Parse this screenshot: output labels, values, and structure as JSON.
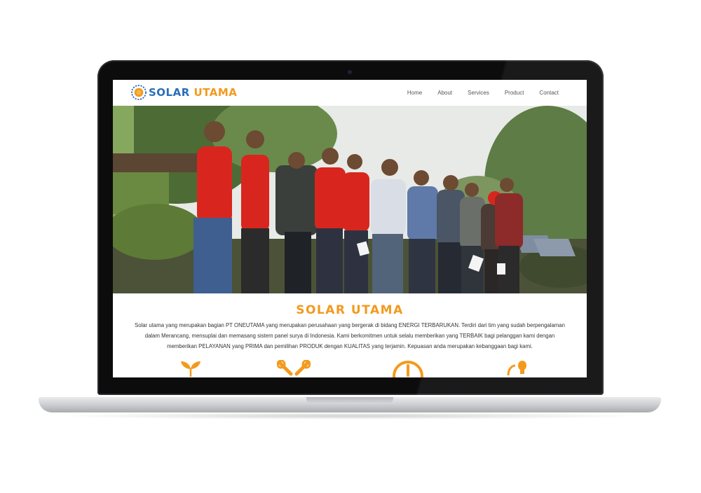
{
  "site": {
    "logo": {
      "part1": "SOLAR",
      "part2": "UTAMA"
    },
    "nav": [
      "Home",
      "About",
      "Services",
      "Product",
      "Contact"
    ]
  },
  "hero": {
    "slides": 3,
    "active_slide": 3
  },
  "intro": {
    "title": "SOLAR UTAMA",
    "paragraph": "Solar utama yang merupakan bagian PT ONEUTAMA yang merupakan perusahaan yang bergerak di bidang ENERGI TERBARUKAN. Terdiri dari tim yang sudah berpengalaman dalam Merancang, mensuplai dan memasang sistem panel surya di Indonesia. Kami berkomitmen untuk selalu memberikan yang TERBAIK bagi pelanggan kami dengan memberikan PELAYANAN yang PRIMA dan pemilihan PRODUK dengan KUALITAS yang terjamin. Kepuasan anda merupakan kebanggaan bagi kami."
  },
  "feature_icons": [
    "leaf-icon",
    "tools-icon",
    "power-icon",
    "bulb-icon"
  ],
  "colors": {
    "accent": "#f39a1d",
    "brand_blue": "#2a6fb7",
    "shirt_red": "#d8261f"
  }
}
